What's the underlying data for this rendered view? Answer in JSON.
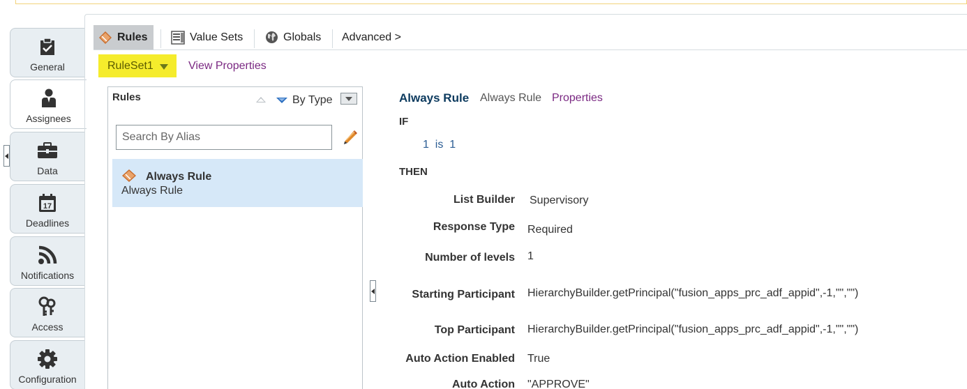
{
  "left_nav": {
    "items": [
      {
        "label": "General",
        "icon": "clipboard-check-icon"
      },
      {
        "label": "Assignees",
        "icon": "person-icon"
      },
      {
        "label": "Data",
        "icon": "briefcase-icon"
      },
      {
        "label": "Deadlines",
        "icon": "calendar-icon",
        "calendar_day": "17"
      },
      {
        "label": "Notifications",
        "icon": "rss-icon"
      },
      {
        "label": "Access",
        "icon": "keys-icon"
      },
      {
        "label": "Configuration",
        "icon": "gear-icon"
      }
    ],
    "active": "Assignees"
  },
  "top_tabs": {
    "rules": "Rules",
    "value_sets": "Value Sets",
    "globals": "Globals",
    "advanced": "Advanced >"
  },
  "ruleset": {
    "name": "RuleSet1",
    "view_properties": "View Properties"
  },
  "rules_panel": {
    "title": "Rules",
    "sort_label": "By Type",
    "search_placeholder": "Search By Alias",
    "items": [
      {
        "name": "Always Rule",
        "description": "Always Rule"
      }
    ]
  },
  "rule_detail": {
    "title": "Always Rule",
    "subtitle": "Always Rule",
    "properties_link": "Properties",
    "if_label": "IF",
    "condition": "1  is  1",
    "then_label": "THEN",
    "properties": [
      {
        "label": "List Builder",
        "value": "Supervisory"
      },
      {
        "label": "Response Type",
        "value": "Required"
      },
      {
        "label": "Number of levels",
        "value": "1"
      },
      {
        "label": "Starting Participant",
        "value": "HierarchyBuilder.getPrincipal(\"fusion_apps_prc_adf_appid\",-1,\"\",\"\")"
      },
      {
        "label": "Top Participant",
        "value": "HierarchyBuilder.getPrincipal(\"fusion_apps_prc_adf_appid\",-1,\"\",\"\")"
      },
      {
        "label": "Auto Action Enabled",
        "value": "True"
      },
      {
        "label": "Auto Action",
        "value": "\"APPROVE\""
      }
    ]
  },
  "colors": {
    "ruleset_highlight": "#f5ec2c",
    "selected_row": "#d6e8f8",
    "link_purple": "#7a2882",
    "title_navy": "#0c3a5e",
    "active_tab": "#c9cccf"
  }
}
